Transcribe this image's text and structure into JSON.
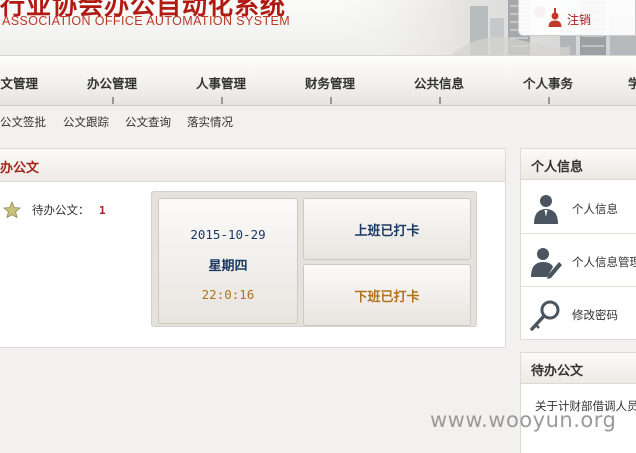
{
  "header": {
    "title": "行业协会办公自动化系统",
    "subtitle": "ASSOCIATION  OFFICE AUTOMATION SYSTEM",
    "logout_label": "注销"
  },
  "nav": {
    "items": [
      "公文管理",
      "办公管理",
      "人事管理",
      "财务管理",
      "公共信息",
      "个人事务",
      "学"
    ]
  },
  "subnav": {
    "items": [
      "公文签批",
      "公文跟踪",
      "公文查询",
      "落实情况"
    ]
  },
  "pending_panel": {
    "title": "待办公文",
    "pending_label": "待办公文：",
    "pending_count": "1"
  },
  "clock": {
    "date": "2015-10-29",
    "weekday": "星期四",
    "time": "22:0:16",
    "clock_in_label": "上班已打卡",
    "clock_out_label": "下班已打卡"
  },
  "personal_panel": {
    "title": "个人信息",
    "items": [
      {
        "label": "个人信息",
        "icon": "user-icon"
      },
      {
        "label": "个人信息管理",
        "icon": "user-edit-icon"
      },
      {
        "label": "修改密码",
        "icon": "key-icon"
      }
    ]
  },
  "pending_docs_panel": {
    "title": "待办公文",
    "first_doc": "关于计财部借调人员"
  },
  "watermark": "www.wooyun.org",
  "colors": {
    "brand_red": "#a3221a",
    "navy": "#1b3a63",
    "amber": "#b0721a"
  }
}
